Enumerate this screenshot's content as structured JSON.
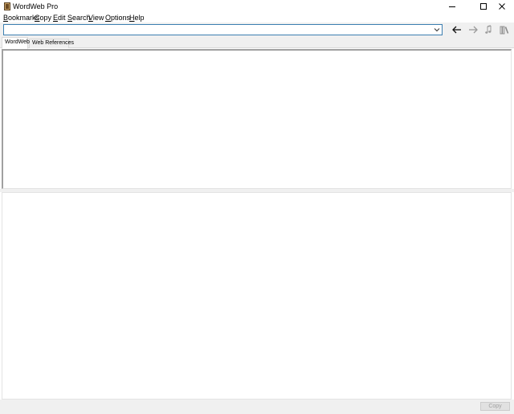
{
  "window": {
    "title": "WordWeb Pro"
  },
  "menu": {
    "items": [
      {
        "label": "Bookmarks",
        "accel": "B",
        "rest": "ookmarks"
      },
      {
        "label": "Copy",
        "accel": "C",
        "rest": "opy"
      },
      {
        "label": "Edit",
        "accel": "E",
        "rest": "dit"
      },
      {
        "label": "Search",
        "accel": "S",
        "rest": "earch"
      },
      {
        "label": "View",
        "accel": "V",
        "rest": "iew"
      },
      {
        "label": "Options",
        "accel": "O",
        "rest": "ptions"
      },
      {
        "label": "Help",
        "accel": "H",
        "rest": "elp"
      }
    ]
  },
  "toolbar": {
    "search_value": "",
    "back_icon": "arrow-left-icon",
    "forward_icon": "arrow-right-icon",
    "audio_icon": "music-note-icon",
    "library_icon": "books-icon"
  },
  "tabs": [
    {
      "label": "WordWeb",
      "active": true
    },
    {
      "label": "Web References",
      "active": false
    }
  ],
  "status": {
    "copy_label": "Copy",
    "copy_enabled": false
  },
  "colors": {
    "input_border": "#3c7fb1",
    "chrome_bg": "#f0f0f0"
  }
}
